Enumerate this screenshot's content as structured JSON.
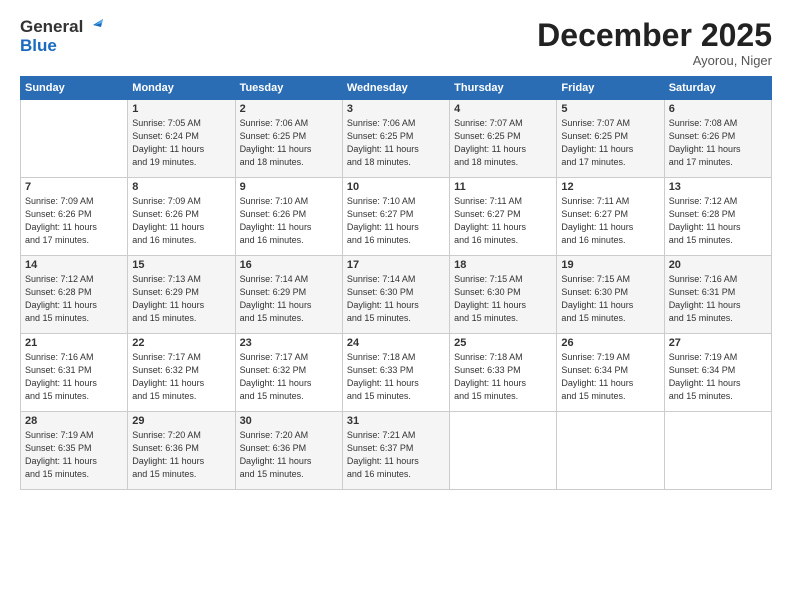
{
  "header": {
    "logo_general": "General",
    "logo_blue": "Blue",
    "month_title": "December 2025",
    "location": "Ayorou, Niger"
  },
  "weekdays": [
    "Sunday",
    "Monday",
    "Tuesday",
    "Wednesday",
    "Thursday",
    "Friday",
    "Saturday"
  ],
  "weeks": [
    [
      {
        "day": "",
        "info": ""
      },
      {
        "day": "1",
        "info": "Sunrise: 7:05 AM\nSunset: 6:24 PM\nDaylight: 11 hours\nand 19 minutes."
      },
      {
        "day": "2",
        "info": "Sunrise: 7:06 AM\nSunset: 6:25 PM\nDaylight: 11 hours\nand 18 minutes."
      },
      {
        "day": "3",
        "info": "Sunrise: 7:06 AM\nSunset: 6:25 PM\nDaylight: 11 hours\nand 18 minutes."
      },
      {
        "day": "4",
        "info": "Sunrise: 7:07 AM\nSunset: 6:25 PM\nDaylight: 11 hours\nand 18 minutes."
      },
      {
        "day": "5",
        "info": "Sunrise: 7:07 AM\nSunset: 6:25 PM\nDaylight: 11 hours\nand 17 minutes."
      },
      {
        "day": "6",
        "info": "Sunrise: 7:08 AM\nSunset: 6:26 PM\nDaylight: 11 hours\nand 17 minutes."
      }
    ],
    [
      {
        "day": "7",
        "info": "Sunrise: 7:09 AM\nSunset: 6:26 PM\nDaylight: 11 hours\nand 17 minutes."
      },
      {
        "day": "8",
        "info": "Sunrise: 7:09 AM\nSunset: 6:26 PM\nDaylight: 11 hours\nand 16 minutes."
      },
      {
        "day": "9",
        "info": "Sunrise: 7:10 AM\nSunset: 6:26 PM\nDaylight: 11 hours\nand 16 minutes."
      },
      {
        "day": "10",
        "info": "Sunrise: 7:10 AM\nSunset: 6:27 PM\nDaylight: 11 hours\nand 16 minutes."
      },
      {
        "day": "11",
        "info": "Sunrise: 7:11 AM\nSunset: 6:27 PM\nDaylight: 11 hours\nand 16 minutes."
      },
      {
        "day": "12",
        "info": "Sunrise: 7:11 AM\nSunset: 6:27 PM\nDaylight: 11 hours\nand 16 minutes."
      },
      {
        "day": "13",
        "info": "Sunrise: 7:12 AM\nSunset: 6:28 PM\nDaylight: 11 hours\nand 15 minutes."
      }
    ],
    [
      {
        "day": "14",
        "info": "Sunrise: 7:12 AM\nSunset: 6:28 PM\nDaylight: 11 hours\nand 15 minutes."
      },
      {
        "day": "15",
        "info": "Sunrise: 7:13 AM\nSunset: 6:29 PM\nDaylight: 11 hours\nand 15 minutes."
      },
      {
        "day": "16",
        "info": "Sunrise: 7:14 AM\nSunset: 6:29 PM\nDaylight: 11 hours\nand 15 minutes."
      },
      {
        "day": "17",
        "info": "Sunrise: 7:14 AM\nSunset: 6:30 PM\nDaylight: 11 hours\nand 15 minutes."
      },
      {
        "day": "18",
        "info": "Sunrise: 7:15 AM\nSunset: 6:30 PM\nDaylight: 11 hours\nand 15 minutes."
      },
      {
        "day": "19",
        "info": "Sunrise: 7:15 AM\nSunset: 6:30 PM\nDaylight: 11 hours\nand 15 minutes."
      },
      {
        "day": "20",
        "info": "Sunrise: 7:16 AM\nSunset: 6:31 PM\nDaylight: 11 hours\nand 15 minutes."
      }
    ],
    [
      {
        "day": "21",
        "info": "Sunrise: 7:16 AM\nSunset: 6:31 PM\nDaylight: 11 hours\nand 15 minutes."
      },
      {
        "day": "22",
        "info": "Sunrise: 7:17 AM\nSunset: 6:32 PM\nDaylight: 11 hours\nand 15 minutes."
      },
      {
        "day": "23",
        "info": "Sunrise: 7:17 AM\nSunset: 6:32 PM\nDaylight: 11 hours\nand 15 minutes."
      },
      {
        "day": "24",
        "info": "Sunrise: 7:18 AM\nSunset: 6:33 PM\nDaylight: 11 hours\nand 15 minutes."
      },
      {
        "day": "25",
        "info": "Sunrise: 7:18 AM\nSunset: 6:33 PM\nDaylight: 11 hours\nand 15 minutes."
      },
      {
        "day": "26",
        "info": "Sunrise: 7:19 AM\nSunset: 6:34 PM\nDaylight: 11 hours\nand 15 minutes."
      },
      {
        "day": "27",
        "info": "Sunrise: 7:19 AM\nSunset: 6:34 PM\nDaylight: 11 hours\nand 15 minutes."
      }
    ],
    [
      {
        "day": "28",
        "info": "Sunrise: 7:19 AM\nSunset: 6:35 PM\nDaylight: 11 hours\nand 15 minutes."
      },
      {
        "day": "29",
        "info": "Sunrise: 7:20 AM\nSunset: 6:36 PM\nDaylight: 11 hours\nand 15 minutes."
      },
      {
        "day": "30",
        "info": "Sunrise: 7:20 AM\nSunset: 6:36 PM\nDaylight: 11 hours\nand 15 minutes."
      },
      {
        "day": "31",
        "info": "Sunrise: 7:21 AM\nSunset: 6:37 PM\nDaylight: 11 hours\nand 16 minutes."
      },
      {
        "day": "",
        "info": ""
      },
      {
        "day": "",
        "info": ""
      },
      {
        "day": "",
        "info": ""
      }
    ]
  ]
}
